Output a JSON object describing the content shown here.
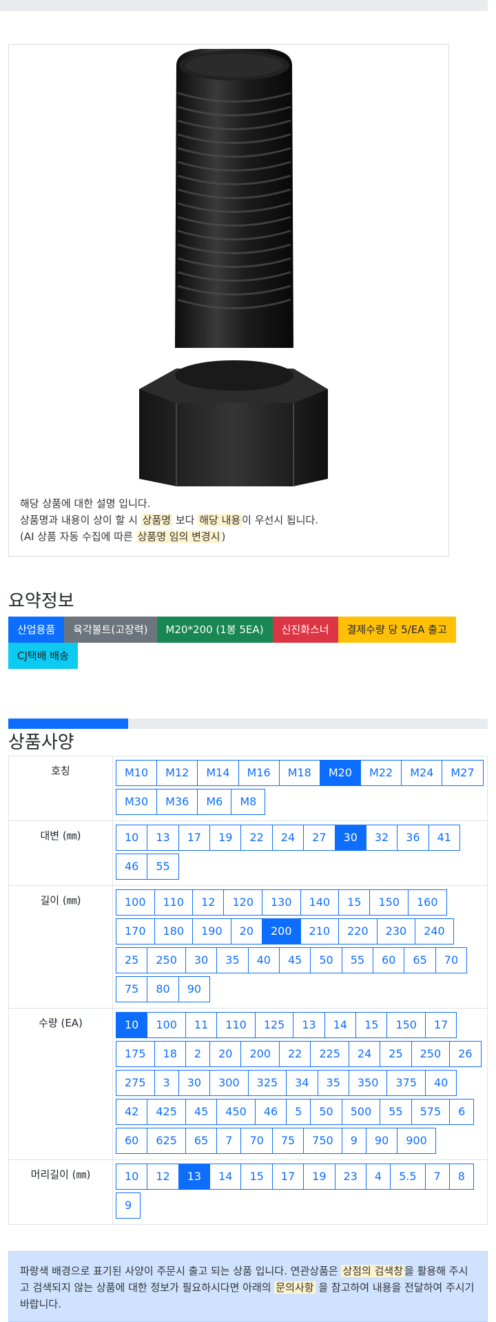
{
  "description": {
    "line1": "해당 상품에 대한 설명 입니다.",
    "line2_pre": "상품명과 내용이 상이 할 시 ",
    "line2_hl1": "상품명",
    "line2_mid": " 보다 ",
    "line2_hl2": "해당 내용",
    "line2_post": "이 우선시 됩니다.",
    "line3_pre": "(AI 상품 자동 수집에 따른 ",
    "line3_hl": "상품명 임의 변경시",
    "line3_post": ")"
  },
  "summary": {
    "title": "요약정보",
    "tags": [
      {
        "label": "산업용품",
        "color": "#0d6efd"
      },
      {
        "label": "육각볼트(고장력)",
        "color": "#6c757d"
      },
      {
        "label": "M20*200 (1봉 5EA)",
        "color": "#198754"
      },
      {
        "label": "신진화스너",
        "color": "#dc3545"
      },
      {
        "label": "결제수량 당 5/EA 출고",
        "color": "#ffc107"
      },
      {
        "label": "CJ택배 배송",
        "color": "#0dcaf0"
      }
    ]
  },
  "progress": {
    "value": 0.25
  },
  "specs": {
    "title": "상품사양",
    "rows": [
      {
        "label": "호칭",
        "selected": "M20",
        "options": [
          "M10",
          "M12",
          "M14",
          "M16",
          "M18",
          "M20",
          "M22",
          "M24",
          "M27",
          "M30",
          "M36",
          "M6",
          "M8"
        ]
      },
      {
        "label": "대변 (㎜)",
        "selected": "30",
        "options": [
          "10",
          "13",
          "17",
          "19",
          "22",
          "24",
          "27",
          "30",
          "32",
          "36",
          "41",
          "46",
          "55"
        ]
      },
      {
        "label": "길이 (㎜)",
        "selected": "200",
        "options": [
          "100",
          "110",
          "12",
          "120",
          "130",
          "140",
          "15",
          "150",
          "160",
          "170",
          "180",
          "190",
          "20",
          "200",
          "210",
          "220",
          "230",
          "240",
          "25",
          "250",
          "30",
          "35",
          "40",
          "45",
          "50",
          "55",
          "60",
          "65",
          "70",
          "75",
          "80",
          "90"
        ]
      },
      {
        "label": "수량 (EA)",
        "selected": "10",
        "options": [
          "10",
          "100",
          "11",
          "110",
          "125",
          "13",
          "14",
          "15",
          "150",
          "17",
          "175",
          "18",
          "2",
          "20",
          "200",
          "22",
          "225",
          "24",
          "25",
          "250",
          "26",
          "275",
          "3",
          "30",
          "300",
          "325",
          "34",
          "35",
          "350",
          "375",
          "40",
          "42",
          "425",
          "45",
          "450",
          "46",
          "5",
          "50",
          "500",
          "55",
          "575",
          "6",
          "60",
          "625",
          "65",
          "7",
          "70",
          "75",
          "750",
          "9",
          "90",
          "900"
        ]
      },
      {
        "label": "머리길이 (㎜)",
        "selected": "13",
        "options": [
          "10",
          "12",
          "13",
          "14",
          "15",
          "17",
          "19",
          "23",
          "4",
          "5.5",
          "7",
          "8",
          "9"
        ]
      }
    ]
  },
  "notice": {
    "p1": "파랑색 배경으로 표기된 사양이 주문시 출고 되는 상품 입니다. 연관상품은 ",
    "hl1": "상점의 검색창",
    "p2": "을 활용해 주시고 검색되지 않는 상품에 대한 정보가 필요하시다면 아래의 ",
    "hl2": "문의사항",
    "p3": " 을 참고하여 내용을 전달하여 주시기 바랍니다."
  }
}
